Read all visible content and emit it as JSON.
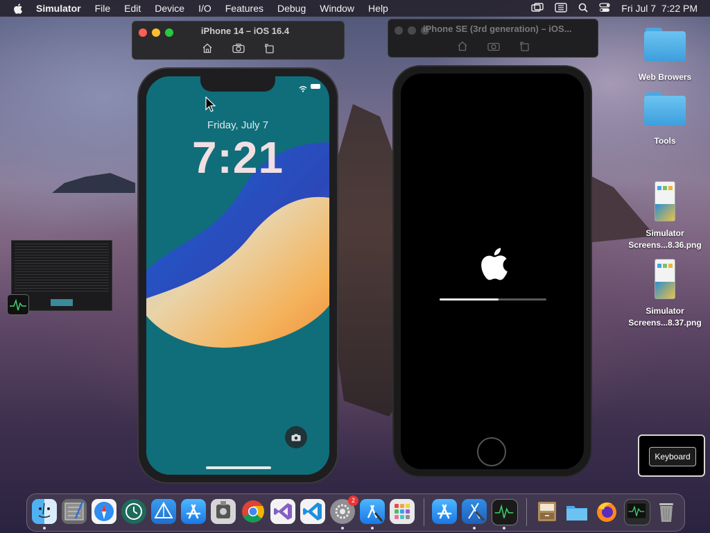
{
  "menubar": {
    "app_name": "Simulator",
    "items": [
      "File",
      "Edit",
      "Device",
      "I/O",
      "Features",
      "Debug",
      "Window",
      "Help"
    ],
    "datetime": "Fri Jul 7  7:22 PM"
  },
  "simulators": [
    {
      "title": "iPhone 14 – iOS 16.4"
    },
    {
      "title": "iPhone SE (3rd generation) – iOS..."
    }
  ],
  "iphone14": {
    "date": "Friday, July 7",
    "time": "7:21"
  },
  "iphonese": {
    "boot_progress": 0.55
  },
  "desktop_icons": [
    {
      "label": "Web Browers"
    },
    {
      "label": "Tools"
    },
    {
      "label_line1": "Simulator",
      "label_line2": "Screens...8.36.png"
    },
    {
      "label_line1": "Simulator",
      "label_line2": "Screens...8.37.png"
    }
  ],
  "keyboard_hud": {
    "label": "Keyboard"
  },
  "dock": {
    "settings_badge": "2"
  }
}
